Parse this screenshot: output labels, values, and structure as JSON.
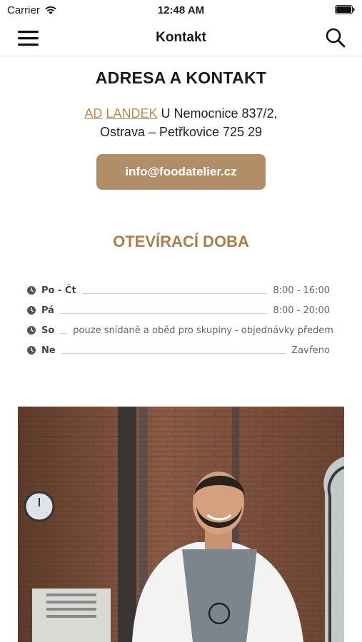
{
  "status_bar": {
    "carrier": "Carrier",
    "time": "12:48 AM"
  },
  "nav": {
    "title": "Kontakt",
    "menu_icon": "hamburger-menu-icon",
    "search_icon": "search-icon"
  },
  "contact": {
    "heading": "ADRESA A KONTAKT",
    "link_1": "AD",
    "link_2": "LANDEK",
    "address_rest": " U Nemocnice 837/2,",
    "address_line2": "Ostrava – Petřkovice 725 29",
    "email": "info@foodatelier.cz"
  },
  "hours": {
    "title": "OTEVÍRACÍ DOBA",
    "rows": [
      {
        "day": "Po - Čt",
        "value": "8:00 - 16:00"
      },
      {
        "day": "Pá",
        "value": "8:00 - 20:00"
      },
      {
        "day": "So",
        "value": "pouze snídaně a oběd pro skupiny - objednávky předem"
      },
      {
        "day": "Ne",
        "value": "Zavřeno"
      }
    ]
  },
  "colors": {
    "accent": "#b08e68",
    "hours_title": "#a87d4f",
    "link": "#b38b5d"
  }
}
